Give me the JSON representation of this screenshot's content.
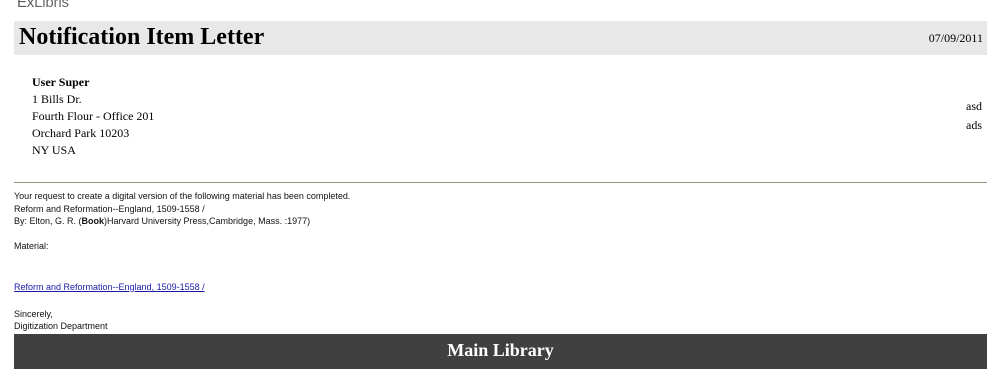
{
  "logo": {
    "part1": "Ex",
    "part2": "Libris"
  },
  "header": {
    "title": "Notification Item Letter",
    "date": "07/09/2011"
  },
  "address": {
    "name": "User Super",
    "line1": "1 Bills Dr.",
    "line2": "Fourth Flour - Office 201",
    "line3": "Orchard Park 10203",
    "line4": "NY USA"
  },
  "side_notes": [
    "asd",
    "ads"
  ],
  "message": {
    "intro": "Your request to create a digital version of the following material has been completed.",
    "title_line": "Reform and Reformation--England, 1509-1558 /",
    "by_prefix": "By: Elton, G. R. (",
    "by_type": "Book",
    "by_suffix": ")Harvard University Press,Cambridge, Mass. :1977)",
    "material_label": "Material:",
    "material_link": "Reform and Reformation--England, 1509-1558 /",
    "closing": "Sincerely,",
    "signature": "Digitization Department"
  },
  "footer": {
    "library": "Main Library"
  }
}
